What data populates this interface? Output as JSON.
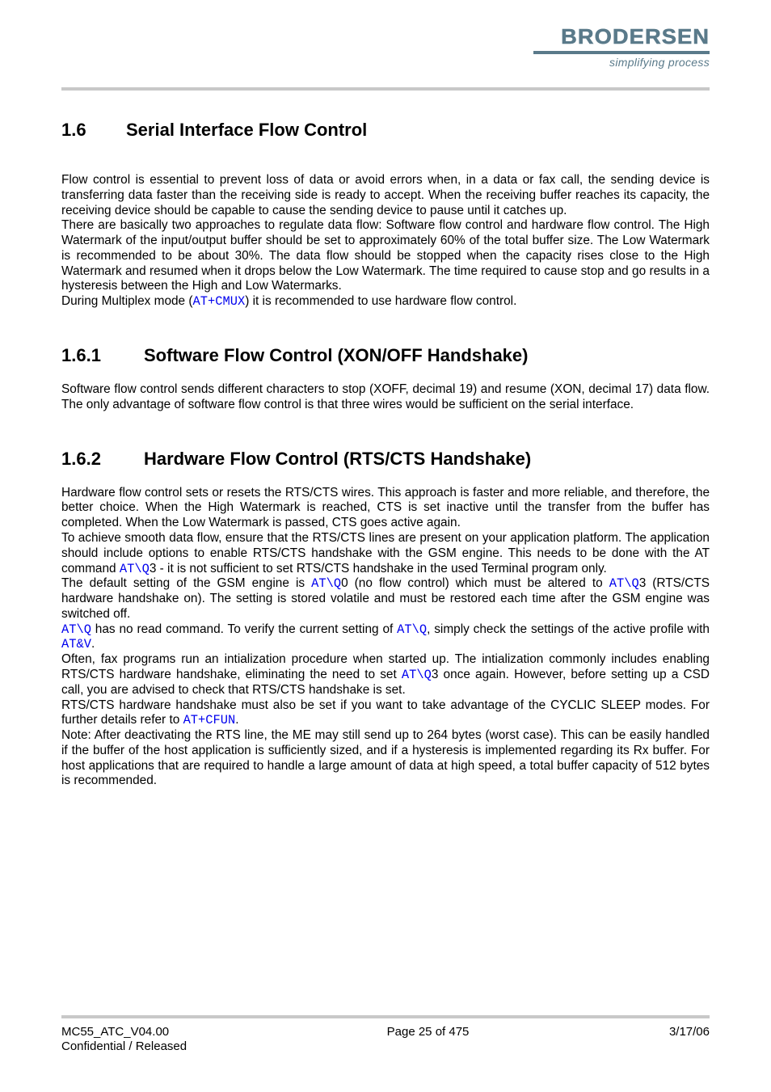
{
  "logo": {
    "name": "BRODERSEN",
    "tagline": "simplifying process"
  },
  "section16": {
    "num": "1.6",
    "title": "Serial Interface Flow Control",
    "p1_a": "Flow control is essential to prevent loss of data or avoid errors when, in a data or fax call, the sending device is transferring data faster than the receiving side is ready to accept. When the receiving buffer reaches its capacity, the receiving device should be capable to cause the sending device to pause until it catches up.",
    "p1_b": "There are basically two approaches to regulate data flow: Software flow control and hardware flow control. The High Watermark of the input/output buffer should be set to approximately 60% of the total buffer size. The Low Watermark is recommended to be about 30%. The data flow should be stopped when the capacity rises close to the High Watermark and resumed when it drops below the Low Watermark. The time required to cause stop and go results in a hysteresis between the High and Low Watermarks.",
    "p1_c_pre": "During Multiplex mode (",
    "p1_c_cmd": "AT+CMUX",
    "p1_c_post": ") it is recommended to use hardware flow control."
  },
  "section161": {
    "num": "1.6.1",
    "title": "Software Flow Control (XON/OFF Handshake)",
    "p1": "Software flow control sends different characters to stop (XOFF, decimal 19) and resume (XON, decimal 17) data flow. The only advantage of software flow control is that three wires would be sufficient on the serial interface."
  },
  "section162": {
    "num": "1.6.2",
    "title": "Hardware Flow Control (RTS/CTS Handshake)",
    "p1": "Hardware flow control sets or resets the RTS/CTS wires. This approach is faster and more reliable, and therefore, the better choice. When the High Watermark is reached, CTS is set inactive until the transfer from the buffer has completed. When the Low Watermark is passed, CTS goes active again.",
    "p2_a": "To achieve smooth data flow, ensure that the RTS/CTS lines are present on your application platform. The application should include options to enable RTS/CTS handshake with the GSM engine. This needs to be done with the AT command ",
    "p2_cmd1": "AT\\Q",
    "p2_b": "3 - it is not sufficient to set RTS/CTS handshake in the used Terminal program only.",
    "p3_a": "The default setting of the GSM engine is ",
    "p3_cmd1": "AT\\Q",
    "p3_b": "0 (no flow control) which must be altered to ",
    "p3_cmd2": "AT\\Q",
    "p3_c": "3 (RTS/CTS hardware handshake on). The setting is stored volatile and must be restored each time after the GSM engine was switched off.",
    "p4_cmd1": "AT\\Q",
    "p4_a": " has no read command. To verify the current setting of ",
    "p4_cmd2": "AT\\Q",
    "p4_b": ", simply check the settings of the active profile with ",
    "p4_cmd3": "AT&V",
    "p4_c": ".",
    "p5_a": "Often, fax programs run an intialization procedure when started up. The intialization commonly includes enabling RTS/CTS hardware handshake, eliminating the need to set ",
    "p5_cmd1": "AT\\Q",
    "p5_b": "3 once again. However, before setting up a CSD call, you are advised to check that RTS/CTS handshake is set.",
    "p6_a": "RTS/CTS hardware handshake must also be set if you want to take advantage of the CYCLIC SLEEP modes. For further details refer to ",
    "p6_cmd1": "AT+CFUN",
    "p6_b": ".",
    "p7": "Note: After deactivating the RTS line, the ME may still send up to 264 bytes (worst case). This can be easily handled if the buffer of the host application is sufficiently sized, and if a hysteresis is implemented regarding its Rx buffer. For host applications that are required to handle a large amount of data at high speed, a total buffer capacity of 512 bytes is recommended."
  },
  "footer": {
    "doc_id": "MC55_ATC_V04.00",
    "classification": "Confidential / Released",
    "page": "Page 25 of 475",
    "date": "3/17/06"
  }
}
